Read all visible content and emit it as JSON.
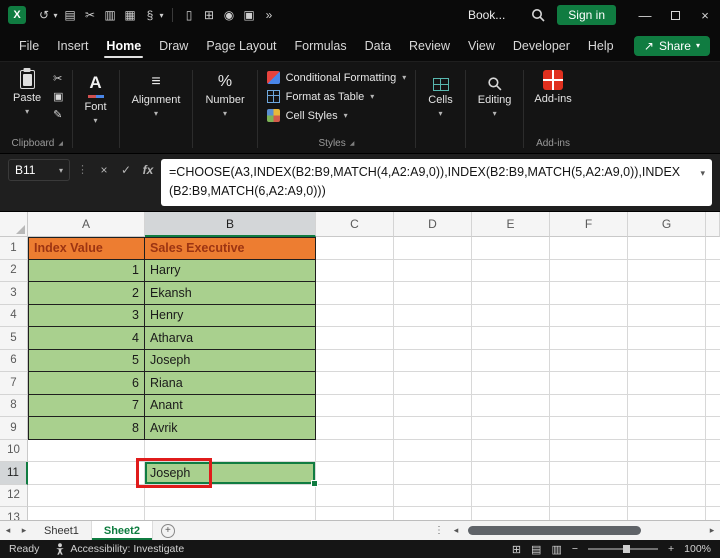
{
  "colors": {
    "excel_green": "#107C41",
    "cell_fill_green": "#A9D08E",
    "header_fill_orange": "#ED7D31",
    "header_text_red": "#9C3412",
    "annotation_red": "#E01B1B",
    "titlebar_black": "#0a0a0a"
  },
  "glyphs": {
    "logo_x": "X",
    "undo": "↺",
    "chevron": "▾",
    "clipboard": "▤",
    "scissors": "✂",
    "copy": "▣",
    "pencil": "✎",
    "notebook": "▥",
    "calculator": "▦",
    "section": "§",
    "document": "▯",
    "grid": "⊞",
    "camera": "◉",
    "table": "▣",
    "overflow": "»",
    "minimize": "—",
    "close": "×",
    "dots": "⋮",
    "cancel": "×",
    "check": "✓",
    "align": "≡",
    "percent": "%",
    "font_a": "A",
    "plus": "+",
    "minus": "−",
    "tri_left": "◂",
    "tri_right": "▸",
    "launcher": "◢",
    "share_arrow": "↗",
    "view_normal": "⊞",
    "view_page": "▤",
    "view_break": "▥"
  },
  "titlebar": {
    "workbook_name": "Book...",
    "signin_label": "Sign in"
  },
  "menubar": {
    "tabs": [
      {
        "label": "File"
      },
      {
        "label": "Insert"
      },
      {
        "label": "Home"
      },
      {
        "label": "Draw"
      },
      {
        "label": "Page Layout"
      },
      {
        "label": "Formulas"
      },
      {
        "label": "Data"
      },
      {
        "label": "Review"
      },
      {
        "label": "View"
      },
      {
        "label": "Developer"
      },
      {
        "label": "Help"
      }
    ],
    "active_tab": "Home",
    "share_label": "Share"
  },
  "ribbon": {
    "paste_label": "Paste",
    "clipboard_group_label": "Clipboard",
    "font_label": "Font",
    "alignment_label": "Alignment",
    "number_label": "Number",
    "conditional_formatting_label": "Conditional Formatting",
    "format_as_table_label": "Format as Table",
    "cell_styles_label": "Cell Styles",
    "styles_group_label": "Styles",
    "cells_label": "Cells",
    "editing_label": "Editing",
    "addins_label": "Add-ins",
    "addins_group_label": "Add-ins"
  },
  "formula_bar": {
    "name_box_value": "B11",
    "fx_label": "fx",
    "formula": "=CHOOSE(A3,INDEX(B2:B9,MATCH(4,A2:A9,0)),INDEX(B2:B9,MATCH(5,A2:A9,0)),INDEX(B2:B9,MATCH(6,A2:A9,0)))"
  },
  "sheet": {
    "columns": [
      "A",
      "B",
      "C",
      "D",
      "E",
      "F",
      "G"
    ],
    "selected_column": "B",
    "selected_row": "11",
    "active_cell": "B11",
    "rows": [
      {
        "n": "1",
        "a": "Index Value",
        "b": "Sales Executive"
      },
      {
        "n": "2",
        "a": "1",
        "b": "Harry"
      },
      {
        "n": "3",
        "a": "2",
        "b": "Ekansh"
      },
      {
        "n": "4",
        "a": "3",
        "b": "Henry"
      },
      {
        "n": "5",
        "a": "4",
        "b": "Atharva"
      },
      {
        "n": "6",
        "a": "5",
        "b": "Joseph"
      },
      {
        "n": "7",
        "a": "6",
        "b": "Riana"
      },
      {
        "n": "8",
        "a": "7",
        "b": "Anant"
      },
      {
        "n": "9",
        "a": "8",
        "b": "Avrik"
      },
      {
        "n": "10",
        "a": "",
        "b": ""
      },
      {
        "n": "11",
        "a": "",
        "b": "Joseph"
      },
      {
        "n": "12",
        "a": "",
        "b": ""
      },
      {
        "n": "13",
        "a": "",
        "b": ""
      }
    ]
  },
  "sheet_tabs": {
    "tabs": [
      {
        "label": "Sheet1"
      },
      {
        "label": "Sheet2"
      }
    ],
    "active": "Sheet2"
  },
  "status_bar": {
    "mode": "Ready",
    "accessibility_label": "Accessibility: Investigate",
    "zoom_level": "100%"
  }
}
